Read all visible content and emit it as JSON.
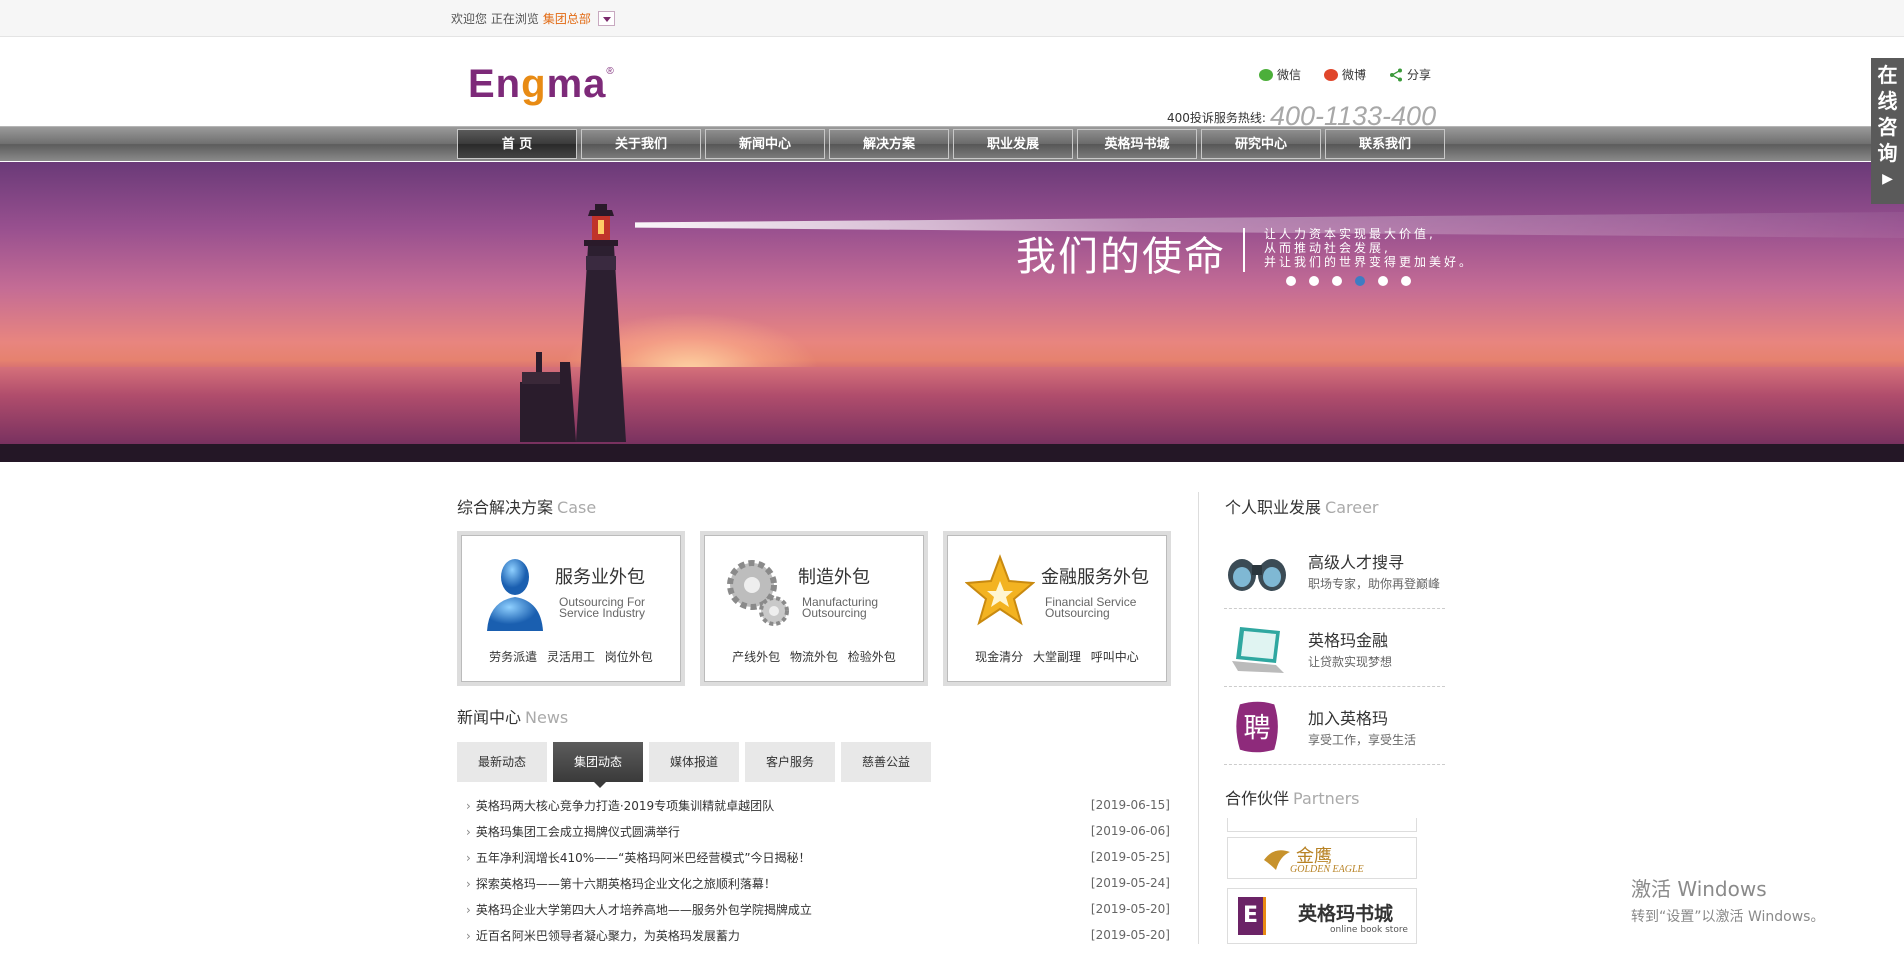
{
  "topbar": {
    "welcome": "欢迎您 正在浏览",
    "current_site": "集团总部"
  },
  "brand": {
    "logo_part1": "En",
    "logo_part2": "g",
    "logo_part3": "ma",
    "registered": "®"
  },
  "social": {
    "wechat": "微信",
    "weibo": "微博",
    "share": "分享"
  },
  "hotline": {
    "label": "400投诉服务热线:",
    "number": "400-1133-400"
  },
  "nav": [
    "首 页",
    "关于我们",
    "新闻中心",
    "解决方案",
    "职业发展",
    "英格玛书城",
    "研究中心",
    "联系我们"
  ],
  "banner": {
    "title": "我们的使命",
    "line1": "让人力资本实现最大价值,",
    "line2": "从而推动社会发展,",
    "line3": "并让我们的世界变得更加美好。",
    "slides": 6,
    "active_slide": 4
  },
  "consult": {
    "label": "在线咨询",
    "arrow": "▶"
  },
  "cases": {
    "title": "综合解决方案",
    "title_en": "Case",
    "items": [
      {
        "name": "服务业外包",
        "en1": "Outsourcing For",
        "en2": "Service Industry",
        "tags": "劳务派遣 灵活用工 岗位外包"
      },
      {
        "name": "制造外包",
        "en1": "Manufacturing",
        "en2": "Outsourcing",
        "tags": "产线外包 物流外包 检验外包"
      },
      {
        "name": "金融服务外包",
        "en1": "Financial Service",
        "en2": "Outsourcing",
        "tags": "现金清分 大堂副理 呼叫中心"
      }
    ]
  },
  "news": {
    "title": "新闻中心",
    "title_en": "News",
    "tabs": [
      "最新动态",
      "集团动态",
      "媒体报道",
      "客户服务",
      "慈善公益"
    ],
    "active_tab": 1,
    "items": [
      {
        "title": "英格玛两大核心竞争力打造·2019专项集训精就卓越团队",
        "date": "[2019-06-15]"
      },
      {
        "title": "英格玛集团工会成立揭牌仪式圆满举行",
        "date": "[2019-06-06]"
      },
      {
        "title": "五年净利润增长410%——“英格玛阿米巴经营模式”今日揭秘！",
        "date": "[2019-05-25]"
      },
      {
        "title": "探索英格玛——第十六期英格玛企业文化之旅顺利落幕！",
        "date": "[2019-05-24]"
      },
      {
        "title": "英格玛企业大学第四大人才培养高地——服务外包学院揭牌成立",
        "date": "[2019-05-20]"
      },
      {
        "title": "近百名阿米巴领导者凝心聚力，为英格玛发展蓄力",
        "date": "[2019-05-20]"
      }
    ]
  },
  "career": {
    "title": "个人职业发展",
    "title_en": "Career",
    "items": [
      {
        "title": "高级人才搜寻",
        "sub": "职场专家，助你再登巅峰",
        "icon": "binoculars-icon"
      },
      {
        "title": "英格玛金融",
        "sub": "让贷款实现梦想",
        "icon": "laptop-icon"
      },
      {
        "title": "加入英格玛",
        "sub": "享受工作，享受生活",
        "icon": "recruit-seal-icon"
      }
    ]
  },
  "partners": {
    "title": "合作伙伴",
    "title_en": "Partners",
    "items": [
      {
        "cn": "金鹰",
        "en": "GOLDEN EAGLE"
      },
      {
        "cn": "英格玛书城",
        "en": "online book store"
      }
    ]
  },
  "watermark": {
    "line1": "激活 Windows",
    "line2": "转到“设置”以激活 Windows。"
  }
}
